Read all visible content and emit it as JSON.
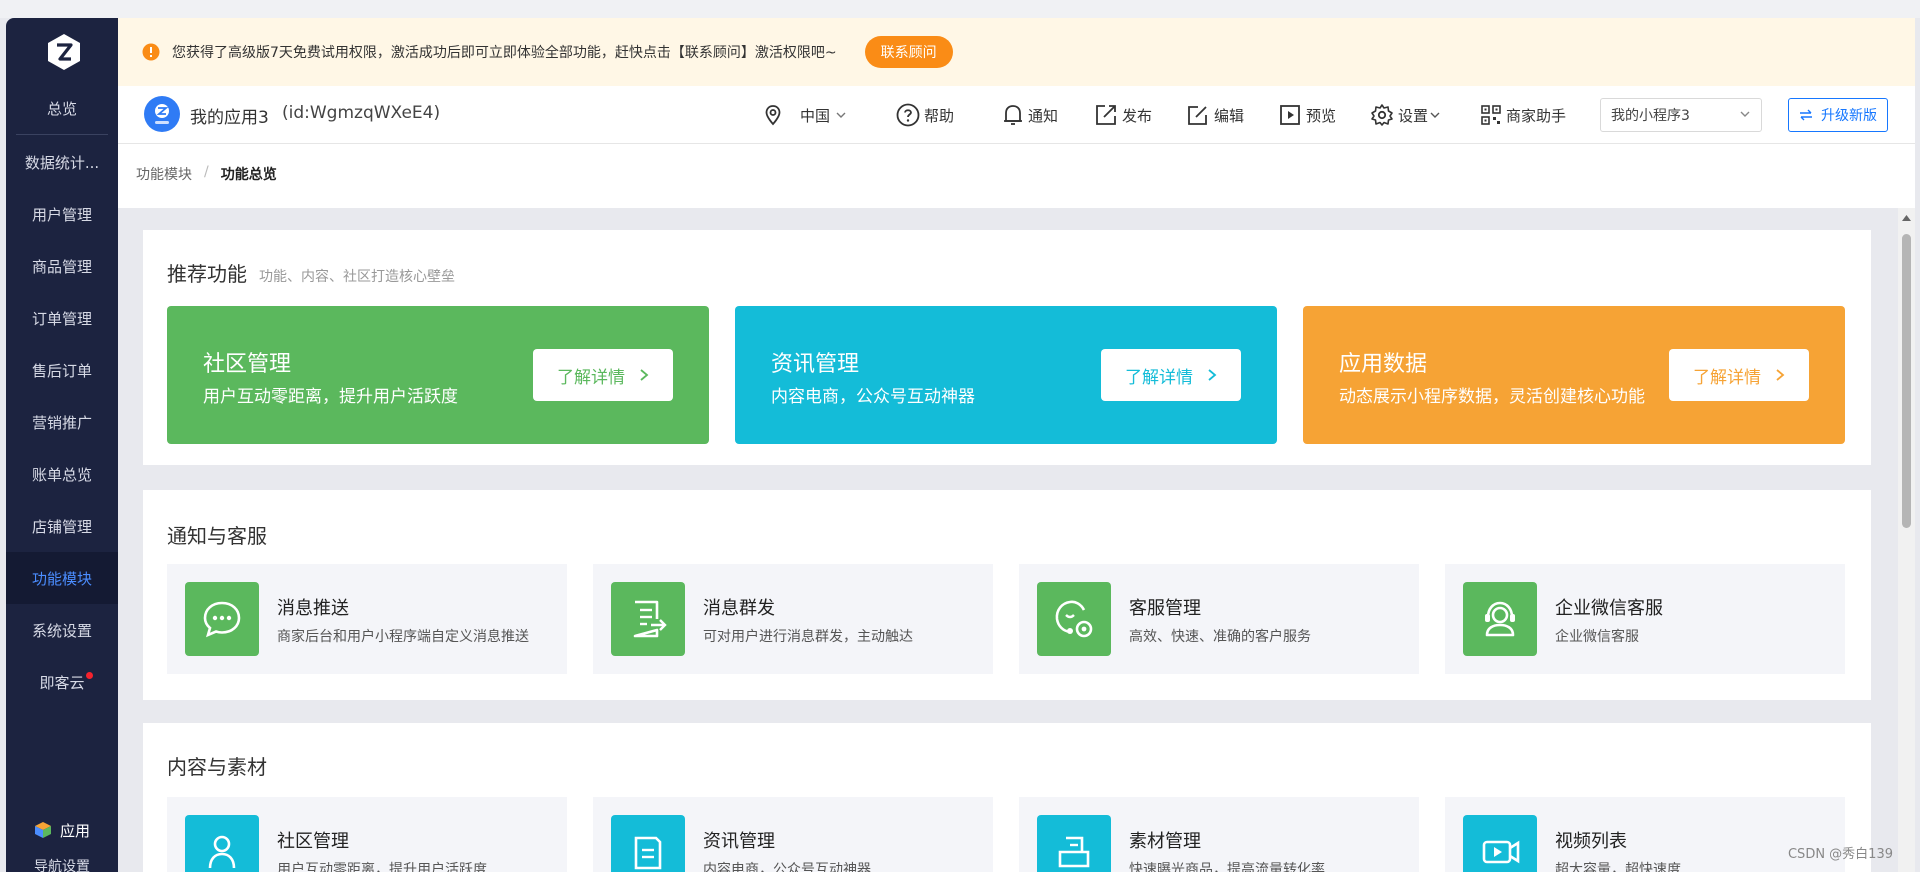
{
  "sidebar": {
    "items": [
      {
        "label": "总览"
      },
      {
        "label": "数据统计..."
      },
      {
        "label": "用户管理"
      },
      {
        "label": "商品管理"
      },
      {
        "label": "订单管理"
      },
      {
        "label": "售后订单"
      },
      {
        "label": "营销推广"
      },
      {
        "label": "账单总览"
      },
      {
        "label": "店铺管理"
      },
      {
        "label": "功能模块"
      },
      {
        "label": "系统设置"
      },
      {
        "label": "即客云"
      }
    ],
    "active_item": "功能模块",
    "app_label": "应用",
    "nav_settings_label": "导航设置"
  },
  "notice": {
    "message": "您获得了高级版7天免费试用权限，激活成功后即可立即体验全部功能，赶快点击【联系顾问】激活权限吧~",
    "button": "联系顾问"
  },
  "header": {
    "app_name": "我的应用3",
    "app_id": "(id:WgmzqWXeE4)",
    "region": "中国",
    "help": "帮助",
    "notify": "通知",
    "publish": "发布",
    "edit": "编辑",
    "preview": "预览",
    "settings": "设置",
    "merchant": "商家助手",
    "mini_program_select": "我的小程序3",
    "upgrade": "升级新版"
  },
  "breadcrumb": {
    "parent": "功能模块",
    "separator": "/",
    "current": "功能总览"
  },
  "recommended": {
    "title": "推荐功能",
    "subtitle": "功能、内容、社区打造核心壁垒",
    "cards": [
      {
        "title": "社区管理",
        "desc": "用户互动零距离，提升用户活跃度",
        "more": "了解详情",
        "color": "#5bb85d"
      },
      {
        "title": "资讯管理",
        "desc": "内容电商，公众号互动神器",
        "more": "了解详情",
        "color": "#14bcd8"
      },
      {
        "title": "应用数据",
        "desc": "动态展示小程序数据，灵活创建核心功能",
        "more": "了解详情",
        "color": "#f6a335"
      }
    ]
  },
  "notify_service": {
    "title": "通知与客服",
    "cards": [
      {
        "title": "消息推送",
        "desc": "商家后台和用户小程序端自定义消息推送",
        "icon": "chat-bubble-icon"
      },
      {
        "title": "消息群发",
        "desc": "可对用户进行消息群发，主动触达",
        "icon": "document-send-icon"
      },
      {
        "title": "客服管理",
        "desc": "高效、快速、准确的客户服务",
        "icon": "service-gear-icon"
      },
      {
        "title": "企业微信客服",
        "desc": "企业微信客服",
        "icon": "headset-user-icon"
      }
    ]
  },
  "content_material": {
    "title": "内容与素材",
    "cards": [
      {
        "title": "社区管理",
        "desc": "用户互动零距离，提升用户活跃度",
        "icon": "community-icon"
      },
      {
        "title": "资讯管理",
        "desc": "内容电商，公众号互动神器",
        "icon": "news-icon"
      },
      {
        "title": "素材管理",
        "desc": "快速曝光商品，提高流量转化率",
        "icon": "material-icon"
      },
      {
        "title": "视频列表",
        "desc": "超大容量，超快速度",
        "icon": "video-icon"
      }
    ]
  },
  "watermark": "CSDN @秀白139",
  "colors": {
    "sidebar_bg": "#1c2340",
    "active_link": "#4b8dff",
    "green": "#5bb85d",
    "cyan": "#14bcd8",
    "orange": "#f6a335",
    "notice_btn": "#fa8c16"
  }
}
